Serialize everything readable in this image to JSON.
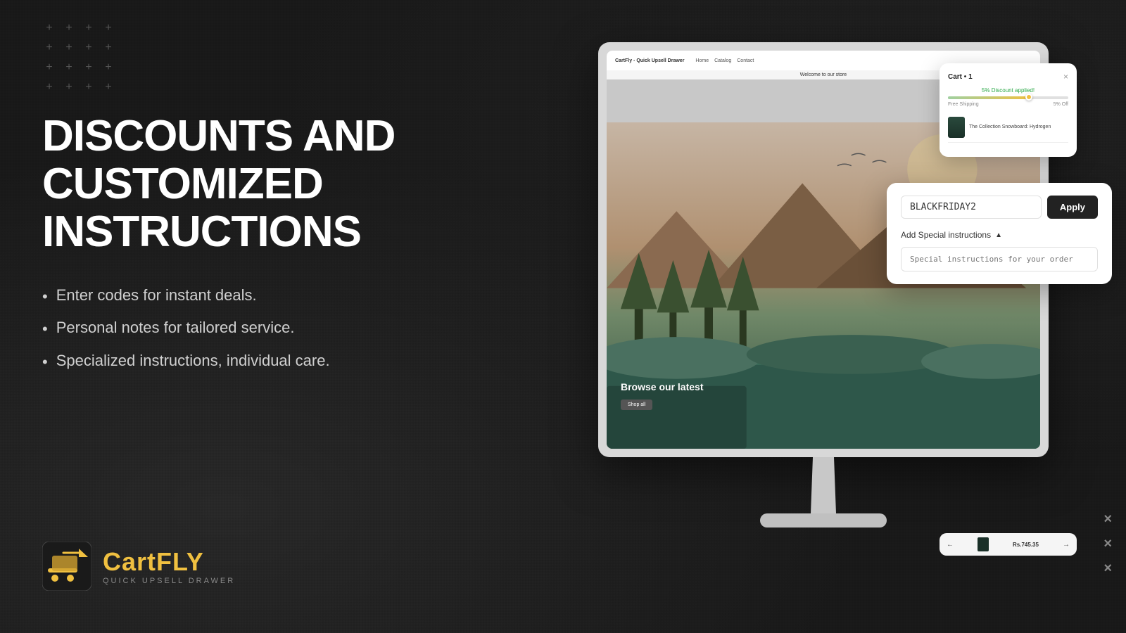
{
  "plusGrid": {
    "symbol": "+"
  },
  "heading": {
    "line1": "DISCOUNTS AND",
    "line2": "CUSTOMIZED",
    "line3": "INSTRUCTIONS"
  },
  "bullets": [
    "Enter codes for instant deals.",
    "Personal notes for tailored service.",
    "Specialized instructions, individual care."
  ],
  "brand": {
    "name_regular": "Cart",
    "name_highlight": "FLY",
    "subtitle": "QUICK UPSELL DRAWER"
  },
  "monitor": {
    "nav": {
      "logo": "CartFly - Quick Upsell Drawer",
      "links": [
        "Home",
        "Catalog",
        "Contact"
      ]
    },
    "banner": "Welcome to our store",
    "browse_text": "Browse our latest",
    "shop_button": "Shop all"
  },
  "cartDrawer": {
    "title": "Cart • 1",
    "close": "×",
    "discount_label": "5% Discount applied!",
    "shipping_free": "Free Shipping",
    "shipping_value": "5% Off",
    "product_name": "The Collection Snowboard: Hydrogen"
  },
  "discountCard": {
    "input_value": "BLACKFRIDAY2",
    "apply_button": "Apply",
    "add_special_label": "Add Special instructions",
    "chevron": "▲",
    "special_placeholder": "Special instructions for your order"
  },
  "cartBottom": {
    "left_arrow": "←",
    "right_arrow": "→",
    "total": "Rs.745.35"
  },
  "xMarks": [
    "×",
    "×",
    "×"
  ]
}
